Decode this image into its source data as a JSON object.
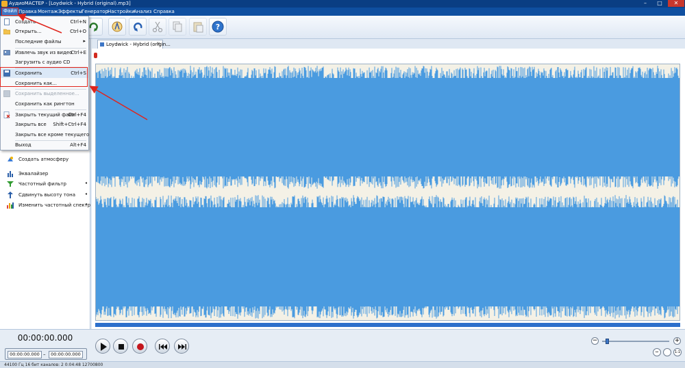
{
  "window": {
    "title": "АудиоМАСТЕР - [Loydwick - Hybrid (original).mp3]",
    "minimize": "–",
    "maximize": "□",
    "close": "✕"
  },
  "menubar": {
    "items": [
      "Файл",
      "Правка",
      "Монтаж",
      "Эффекты",
      "Генератор",
      "Настройки",
      "Анализ",
      "Справка"
    ],
    "active_index": 0
  },
  "toolbar": {
    "icons": [
      "redo-icon",
      "effect-icon",
      "undo-icon",
      "cut-icon",
      "copy-icon",
      "paste-icon",
      "help-icon"
    ]
  },
  "file_menu": {
    "items": [
      {
        "label": "Создать",
        "shortcut": "Ctrl+N",
        "icon": "new-file-icon",
        "enabled": true
      },
      {
        "label": "Открыть...",
        "shortcut": "Ctrl+O",
        "icon": "open-folder-icon",
        "enabled": true
      },
      {
        "label": "Последние файлы",
        "shortcut": "",
        "icon": "",
        "enabled": true,
        "submenu": true
      },
      {
        "label": "Извлечь звук из видео",
        "shortcut": "Ctrl+E",
        "icon": "video-icon",
        "enabled": true
      },
      {
        "label": "Загрузить с аудио CD",
        "shortcut": "",
        "icon": "",
        "enabled": true
      },
      {
        "label": "Сохранить",
        "shortcut": "Ctrl+S",
        "icon": "save-icon",
        "enabled": true
      },
      {
        "label": "Сохранить как...",
        "shortcut": "",
        "icon": "",
        "enabled": true
      },
      {
        "label": "Сохранить выделенное...",
        "shortcut": "",
        "icon": "save-selection-icon",
        "enabled": false
      },
      {
        "label": "Сохранить как рингтон",
        "shortcut": "",
        "icon": "",
        "enabled": true
      },
      {
        "label": "Закрыть текущий файл",
        "shortcut": "Ctrl+F4",
        "icon": "close-file-icon",
        "enabled": true
      },
      {
        "label": "Закрыть все",
        "shortcut": "Shift+Ctrl+F4",
        "icon": "",
        "enabled": true
      },
      {
        "label": "Закрыть все кроме текущего",
        "shortcut": "",
        "icon": "",
        "enabled": true
      },
      {
        "label": "Выход",
        "shortcut": "Alt+F4",
        "icon": "",
        "enabled": true
      }
    ]
  },
  "sidebar": {
    "items": [
      {
        "label": "Создать атмосферу",
        "icon": "atmosphere-icon",
        "has_arrow": false
      },
      {
        "label": "Эквалайзер",
        "icon": "equalizer-icon",
        "has_arrow": false
      },
      {
        "label": "Частотный фильтр",
        "icon": "filter-icon",
        "has_arrow": true
      },
      {
        "label": "Сдвинуть высоту тона",
        "icon": "pitch-icon",
        "has_arrow": true
      },
      {
        "label": "Изменить частотный спектр",
        "icon": "spectrum-icon",
        "has_arrow": true
      }
    ]
  },
  "tab": {
    "label": "Loydwick - Hybrid (origin...",
    "close": "×"
  },
  "colors": {
    "waveform": "#4a9be0",
    "wave_background": "#f4f1e6",
    "titlebar": "#0a3e83",
    "menubar": "#0f4fa0",
    "highlight_box": "#e0241c"
  },
  "playback": {
    "current_time": "00:00:00.000",
    "selection_start": "00:00:00.000",
    "selection_end": "00:00:00.000",
    "selection_separator": "–",
    "buttons": [
      "play-icon",
      "stop-icon",
      "record-icon",
      "rewind-icon",
      "fast-forward-icon"
    ]
  },
  "zoom": {
    "minus": "−",
    "plus": "+",
    "level": 0.05,
    "fit_labels": [
      "↔",
      "1:1"
    ]
  },
  "status": {
    "text": "44100 Гц 16 бит каналов: 2     0:04:48 12700800"
  }
}
